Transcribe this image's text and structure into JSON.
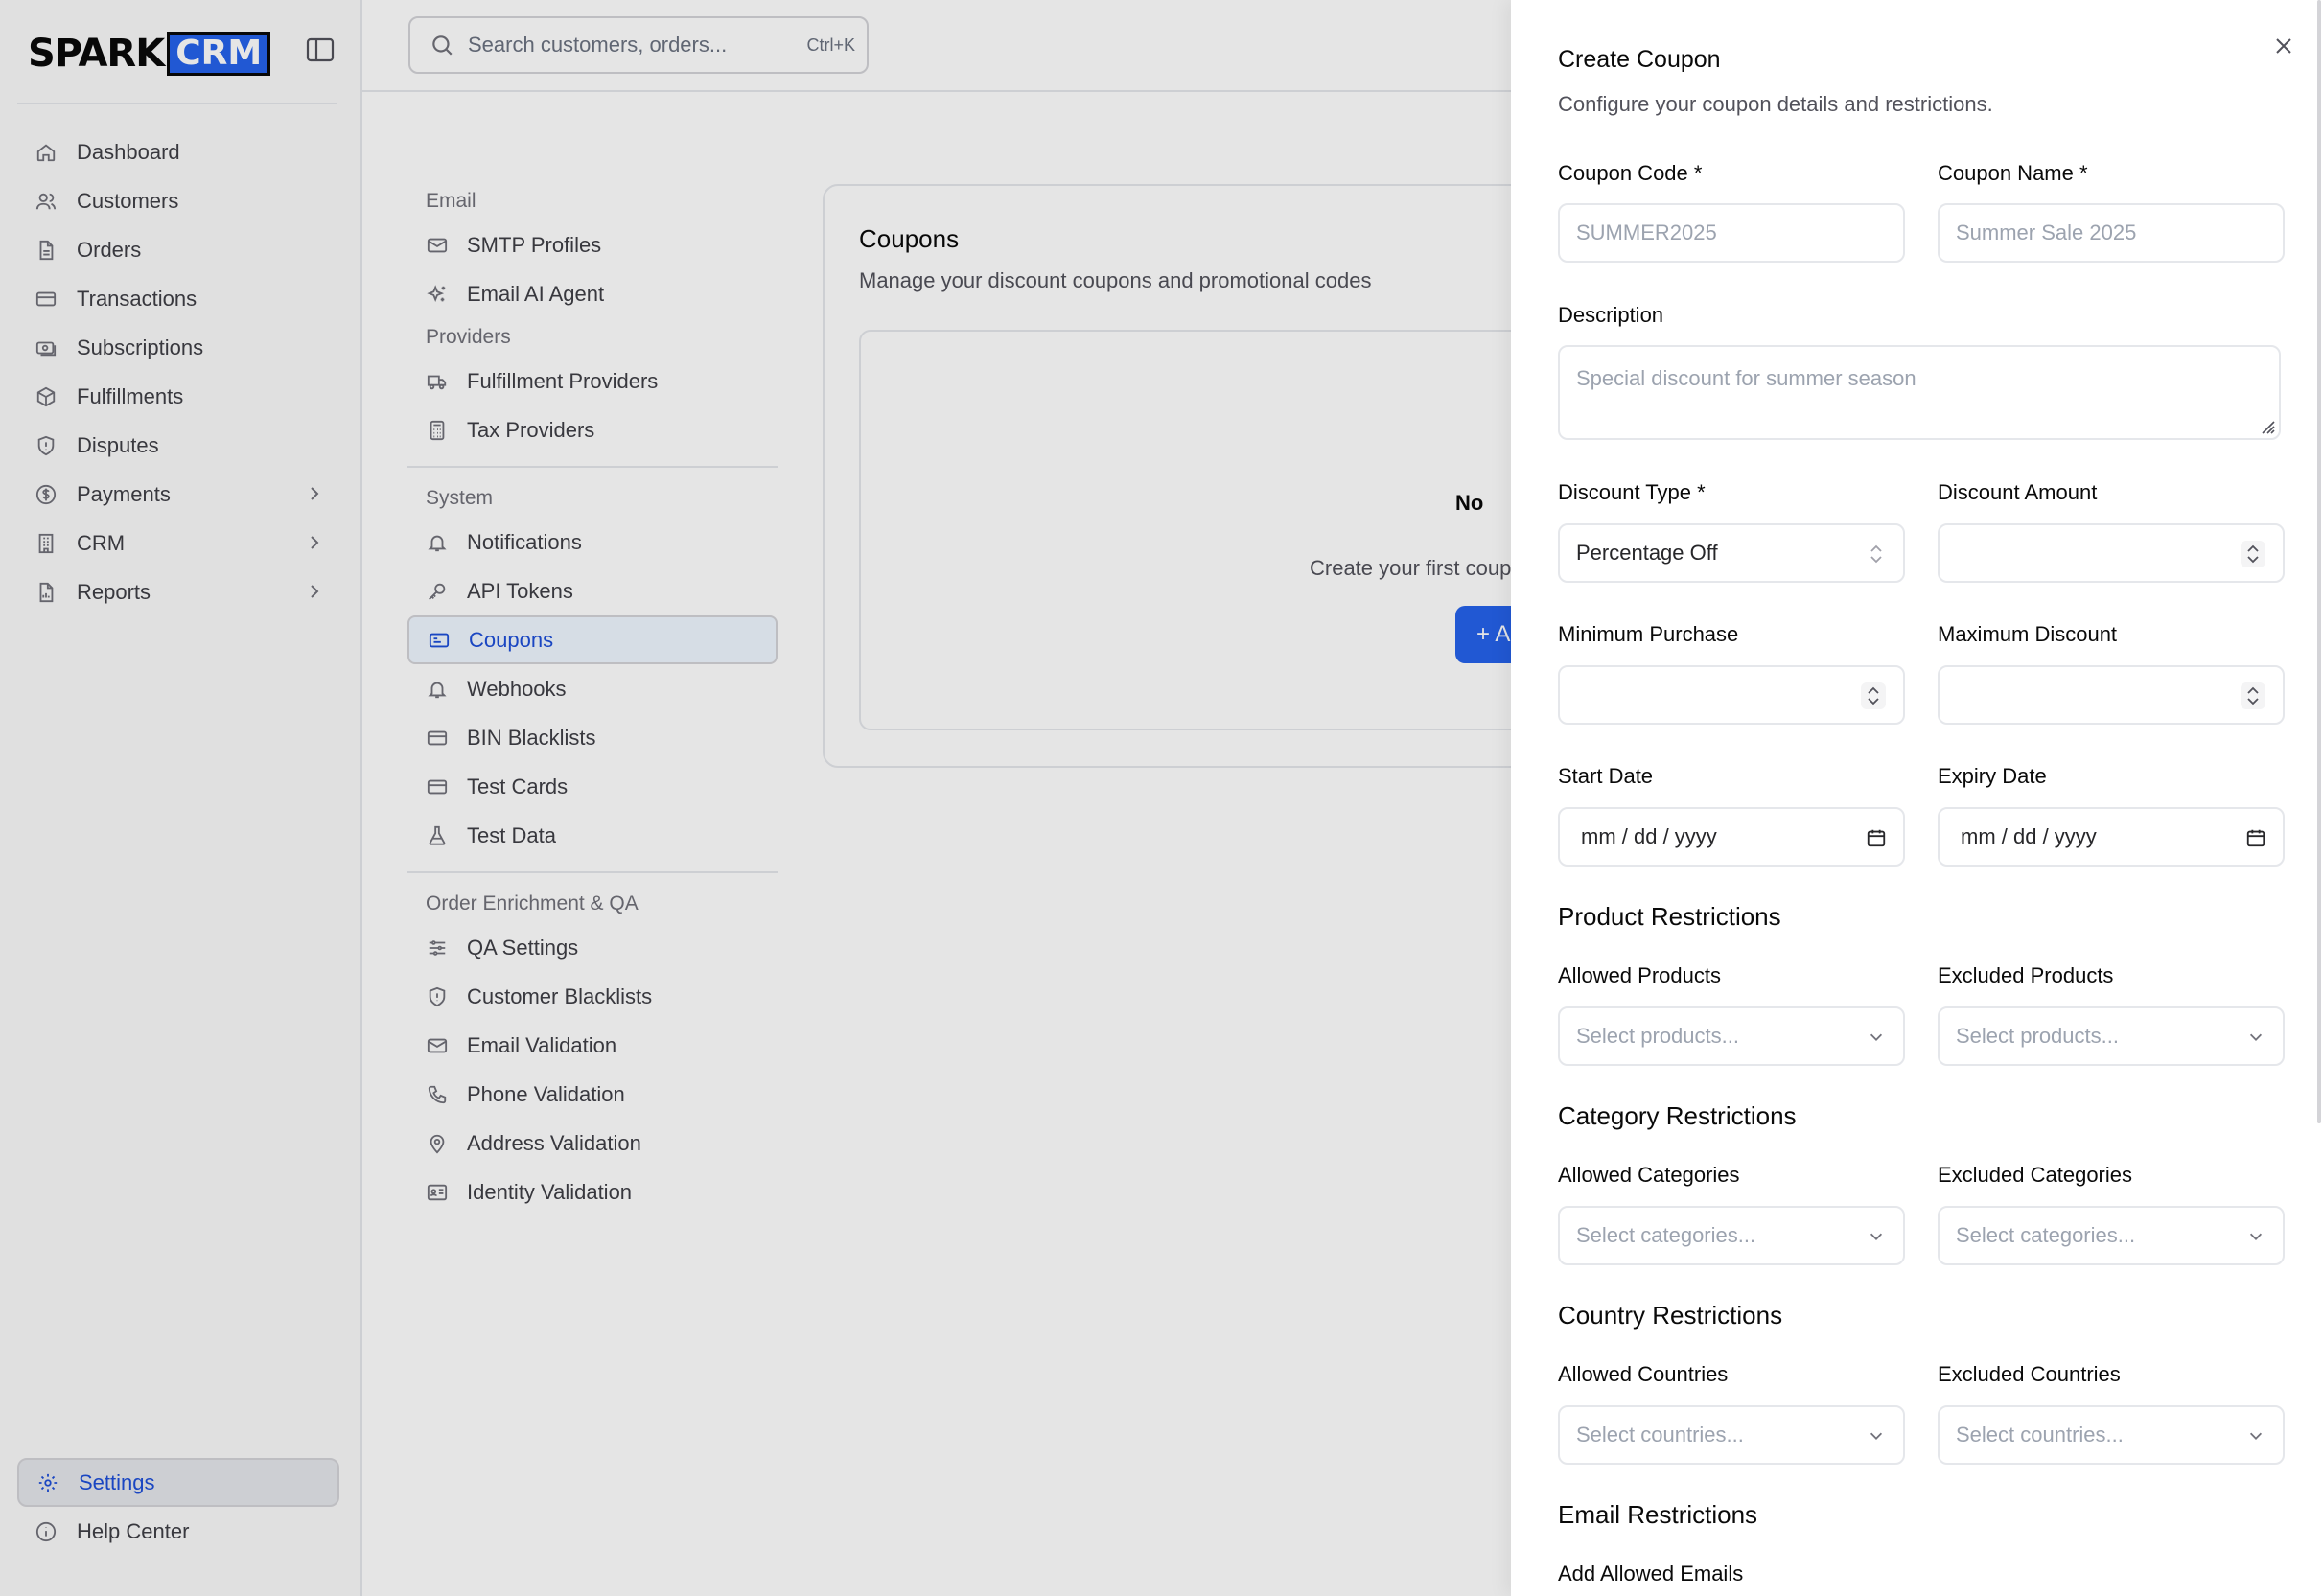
{
  "brand": {
    "spark": "SPARK",
    "crm": "CRM"
  },
  "sidebar": {
    "items": [
      {
        "label": "Dashboard",
        "icon": "home-icon"
      },
      {
        "label": "Customers",
        "icon": "users-icon"
      },
      {
        "label": "Orders",
        "icon": "file-icon"
      },
      {
        "label": "Transactions",
        "icon": "credit-card-icon"
      },
      {
        "label": "Subscriptions",
        "icon": "repeat-money-icon"
      },
      {
        "label": "Fulfillments",
        "icon": "package-icon"
      },
      {
        "label": "Disputes",
        "icon": "shield-icon"
      },
      {
        "label": "Payments",
        "icon": "dollar-circle-icon"
      },
      {
        "label": "CRM",
        "icon": "building-icon"
      },
      {
        "label": "Reports",
        "icon": "report-icon"
      }
    ],
    "bottom": {
      "settings": "Settings",
      "help": "Help Center"
    }
  },
  "search": {
    "placeholder": "Search customers, orders...",
    "shortcut": "Ctrl+K"
  },
  "settings_nav": {
    "email_group": "Email",
    "email_items": [
      "SMTP Profiles",
      "Email AI Agent"
    ],
    "providers_group": "Providers",
    "provider_items": [
      "Fulfillment Providers",
      "Tax Providers"
    ],
    "system_group": "System",
    "system_items": [
      "Notifications",
      "API Tokens",
      "Coupons",
      "Webhooks",
      "BIN Blacklists",
      "Test Cards",
      "Test Data"
    ],
    "qa_group": "Order Enrichment & QA",
    "qa_items": [
      "QA Settings",
      "Customer Blacklists",
      "Email Validation",
      "Phone Validation",
      "Address Validation",
      "Identity Validation"
    ]
  },
  "card": {
    "title": "Coupons",
    "subtitle": "Manage your discount coupons and promotional codes",
    "empty_title_visible": "No",
    "empty_sub_visible": "Create your first coup",
    "add_button": "+  A"
  },
  "drawer": {
    "title": "Create Coupon",
    "subtitle": "Configure your coupon details and restrictions.",
    "coupon_code": {
      "label": "Coupon Code *",
      "placeholder": "SUMMER2025"
    },
    "coupon_name": {
      "label": "Coupon Name *",
      "placeholder": "Summer Sale 2025"
    },
    "description": {
      "label": "Description",
      "placeholder": "Special discount for summer season"
    },
    "discount_type": {
      "label": "Discount Type *",
      "value": "Percentage Off"
    },
    "discount_amount": {
      "label": "Discount Amount"
    },
    "min_purchase": {
      "label": "Minimum Purchase"
    },
    "max_discount": {
      "label": "Maximum Discount"
    },
    "start_date": {
      "label": "Start Date",
      "placeholder": "mm / dd / yyyy"
    },
    "expiry_date": {
      "label": "Expiry Date",
      "placeholder": "mm / dd / yyyy"
    },
    "product_section": "Product Restrictions",
    "allowed_products": {
      "label": "Allowed Products",
      "placeholder": "Select products..."
    },
    "excluded_products": {
      "label": "Excluded Products",
      "placeholder": "Select products..."
    },
    "category_section": "Category Restrictions",
    "allowed_categories": {
      "label": "Allowed Categories",
      "placeholder": "Select categories..."
    },
    "excluded_categories": {
      "label": "Excluded Categories",
      "placeholder": "Select categories..."
    },
    "country_section": "Country Restrictions",
    "allowed_countries": {
      "label": "Allowed Countries",
      "placeholder": "Select countries..."
    },
    "excluded_countries": {
      "label": "Excluded Countries",
      "placeholder": "Select countries..."
    },
    "email_section": "Email Restrictions",
    "allowed_emails": {
      "label": "Add Allowed Emails"
    }
  },
  "colors": {
    "accent": "#2563eb",
    "active_text": "#1d4ed8",
    "border": "#e5e7eb"
  }
}
